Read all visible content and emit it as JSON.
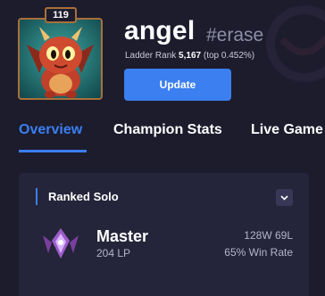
{
  "profile": {
    "level": "119",
    "name": "angel",
    "tag": "#erase",
    "ladder_prefix": "Ladder Rank",
    "ladder_rank": "5,167",
    "ladder_suffix": "(top 0.452%)",
    "update_label": "Update"
  },
  "tabs": [
    {
      "label": "Overview",
      "active": true
    },
    {
      "label": "Champion Stats",
      "active": false
    },
    {
      "label": "Live Game",
      "active": false
    }
  ],
  "ranked": {
    "title": "Ranked Solo",
    "tier": "Master",
    "lp": "204 LP",
    "record": "128W 69L",
    "win_rate": "65% Win Rate"
  },
  "icons": {
    "avatar": "little-dragon-avatar",
    "collapse": "chevron-down-icon",
    "emblem": "master-emblem-icon"
  },
  "colors": {
    "background": "#1c1c2d",
    "card": "#24243a",
    "accent": "#3b7ff0",
    "frame": "#a8703a"
  }
}
